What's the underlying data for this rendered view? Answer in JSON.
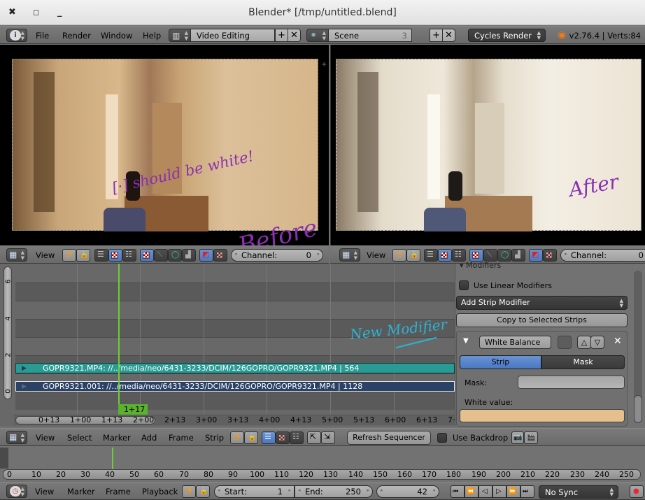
{
  "window": {
    "title": "Blender* [/tmp/untitled.blend]",
    "controls": [
      "close-icon",
      "maximize-icon",
      "minimize-icon"
    ]
  },
  "info_header": {
    "menus": [
      "File",
      "Render",
      "Window",
      "Help"
    ],
    "screen_layout": "Video Editing",
    "scene": "Scene",
    "scene_users": "3",
    "render_engine": "Cycles Render",
    "stats": "v2.76.4 | Verts:84"
  },
  "preview_left": {
    "annotation_main": "[·] should be white!",
    "annotation_label": "Before",
    "header": {
      "view": "View",
      "channel_label": "Channel:",
      "channel_value": "0"
    }
  },
  "preview_right": {
    "annotation_label": "After",
    "header": {
      "view": "View",
      "channel_label": "Channel:",
      "channel_value": "0"
    }
  },
  "sequencer": {
    "y_ticks": [
      "6",
      "4",
      "2",
      "0"
    ],
    "strips": [
      {
        "label": "GOPR9321.MP4: //../media/neo/6431-3233/DCIM/126GOPRO/GOPR9321.MP4 | 564",
        "color": "#2a9a94"
      },
      {
        "label": "GOPR9321.001: //../media/neo/6431-3233/DCIM/126GOPRO/GOPR9321.MP4 | 1128",
        "color": "#2b4266"
      }
    ],
    "playhead_label": "1+17",
    "x_ticks": [
      "0+13",
      "1+00",
      "1+13",
      "2+00",
      "2+13",
      "3+00",
      "3+13",
      "4+00",
      "4+13",
      "5+00",
      "5+13",
      "6+00",
      "6+13",
      "7+"
    ],
    "annotation": "New Modifier",
    "header": {
      "menus": [
        "View",
        "Select",
        "Marker",
        "Add",
        "Frame",
        "Strip"
      ],
      "refresh_button": "Refresh Sequencer",
      "use_backdrop": "Use Backdrop"
    }
  },
  "modifiers_panel": {
    "title": "Modifiers",
    "use_linear_modifiers": "Use Linear Modifiers",
    "add_strip_modifier": "Add Strip Modifier",
    "copy_to_selected": "Copy to Selected Strips",
    "modifier": {
      "name": "White Balance",
      "tabs": [
        "Strip",
        "Mask"
      ],
      "active_tab": "Strip",
      "mask_label": "Mask:",
      "mask_value": "",
      "white_value_label": "White value:",
      "white_value_color": "#e5bf8e"
    }
  },
  "timeline": {
    "ticks": [
      "0",
      "10",
      "20",
      "30",
      "40",
      "50",
      "60",
      "70",
      "80",
      "90",
      "100",
      "110",
      "120",
      "130",
      "140",
      "150",
      "160",
      "170",
      "180",
      "190",
      "200",
      "210",
      "220",
      "230",
      "240",
      "250"
    ],
    "current_frame_marker": 42,
    "header": {
      "menus": [
        "View",
        "Marker",
        "Frame",
        "Playback"
      ],
      "start_label": "Start:",
      "start_value": "1",
      "end_label": "End:",
      "end_value": "250",
      "current_frame": "42",
      "sync": "No Sync"
    }
  }
}
